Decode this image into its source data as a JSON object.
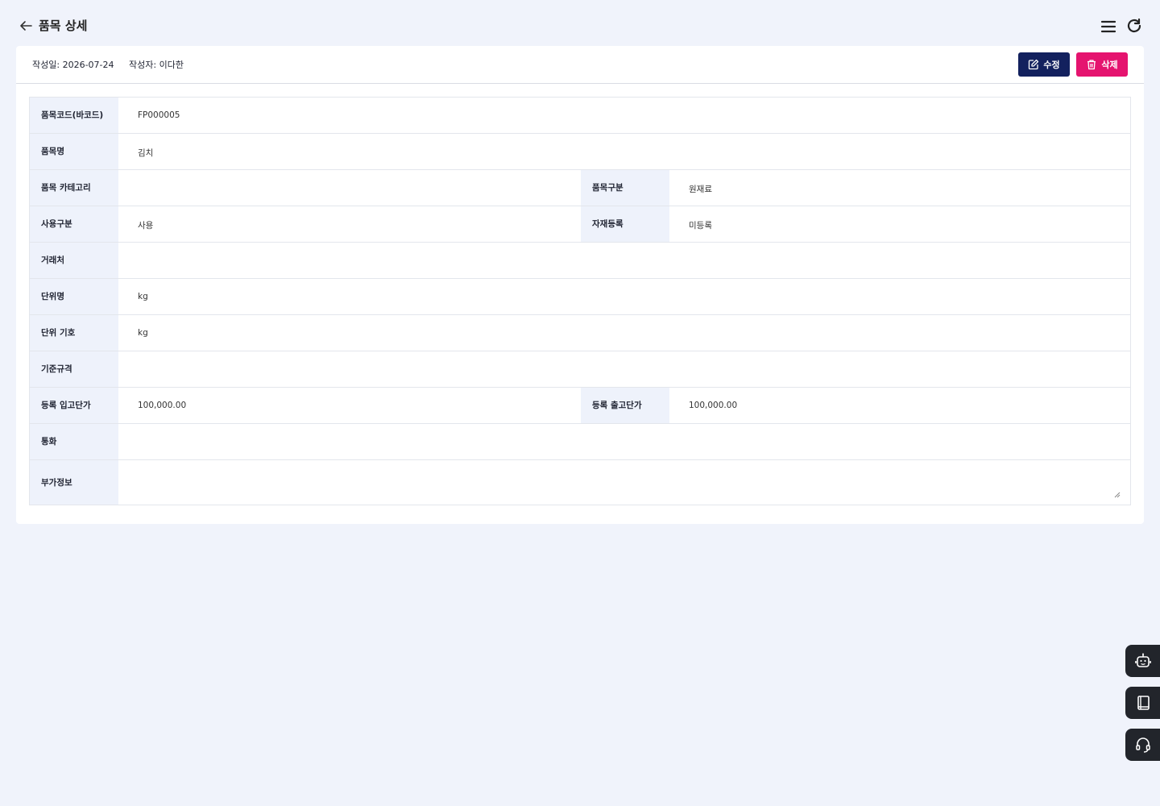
{
  "header": {
    "title": "품목 상세"
  },
  "meta": {
    "created_label": "작성일:",
    "created_value": "2026-07-24",
    "author_label": "작성자:",
    "author_value": "이다한"
  },
  "actions": {
    "edit_label": "수정",
    "delete_label": "삭제"
  },
  "fields": {
    "code": {
      "label": "품목코드(바코드)",
      "value": "FP000005"
    },
    "name": {
      "label": "품목명",
      "value": "김치"
    },
    "category": {
      "label": "품목 카테고리",
      "value": ""
    },
    "type": {
      "label": "품목구분",
      "value": "원재료"
    },
    "usage": {
      "label": "사용구분",
      "value": "사용"
    },
    "material": {
      "label": "자재등록",
      "value": "미등록"
    },
    "vendor": {
      "label": "거래처",
      "value": ""
    },
    "unit_name": {
      "label": "단위명",
      "value": "kg"
    },
    "unit_symbol": {
      "label": "단위 기호",
      "value": "kg"
    },
    "spec": {
      "label": "기준규격",
      "value": ""
    },
    "in_price": {
      "label": "등록 입고단가",
      "value": "100,000.00"
    },
    "out_price": {
      "label": "등록 출고단가",
      "value": "100,000.00"
    },
    "currency": {
      "label": "통화",
      "value": ""
    },
    "extra": {
      "label": "부가정보",
      "value": ""
    }
  }
}
